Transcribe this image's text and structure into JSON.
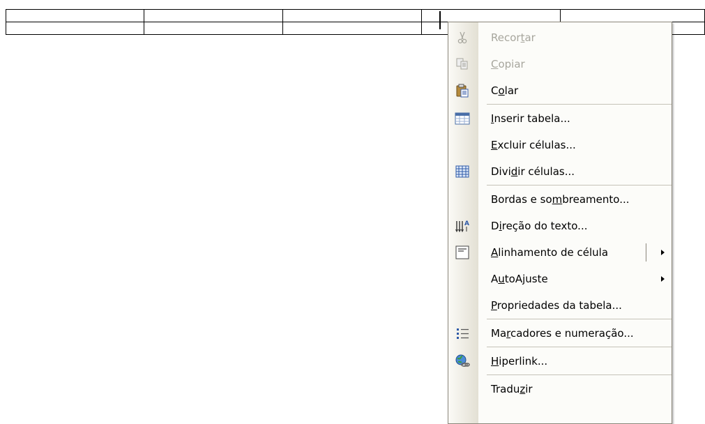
{
  "table": {
    "rows": [
      [
        "",
        "",
        "",
        "",
        ""
      ],
      [
        "",
        "",
        "",
        "",
        ""
      ]
    ]
  },
  "menu": {
    "items": [
      {
        "icon": "scissors-icon",
        "parts": [
          "Recor",
          "t",
          "ar"
        ],
        "disabled": true
      },
      {
        "icon": "copy-icon",
        "parts": [
          "",
          "C",
          "opiar"
        ],
        "disabled": true
      },
      {
        "icon": "paste-icon",
        "parts": [
          "C",
          "o",
          "lar"
        ],
        "disabled": false,
        "sep_after": true
      },
      {
        "icon": "insert-table-icon",
        "parts": [
          "",
          "I",
          "nserir tabela..."
        ],
        "disabled": false
      },
      {
        "icon": "",
        "parts": [
          "",
          "E",
          "xcluir células..."
        ],
        "disabled": false
      },
      {
        "icon": "split-cells-icon",
        "parts": [
          "Divi",
          "d",
          "ir células..."
        ],
        "disabled": false,
        "sep_after": true
      },
      {
        "icon": "",
        "parts": [
          "Bordas e so",
          "m",
          "breamento..."
        ],
        "disabled": false
      },
      {
        "icon": "text-direction-icon",
        "parts": [
          "D",
          "i",
          "reção do texto..."
        ],
        "disabled": false
      },
      {
        "icon": "cell-alignment-icon",
        "parts": [
          "",
          "A",
          "linhamento de célula"
        ],
        "disabled": false,
        "submenu": true,
        "split": true
      },
      {
        "icon": "",
        "parts": [
          "A",
          "u",
          "toAjuste"
        ],
        "disabled": false,
        "submenu": true
      },
      {
        "icon": "",
        "parts": [
          "",
          "P",
          "ropriedades da tabela..."
        ],
        "disabled": false,
        "sep_after": true
      },
      {
        "icon": "bullets-numbering-icon",
        "parts": [
          "Ma",
          "r",
          "cadores e numeração..."
        ],
        "disabled": false,
        "sep_after": true
      },
      {
        "icon": "hyperlink-icon",
        "parts": [
          "",
          "H",
          "iperlink..."
        ],
        "disabled": false,
        "sep_after": true
      },
      {
        "icon": "",
        "parts": [
          "Tradu",
          "z",
          "ir"
        ],
        "disabled": false
      }
    ]
  }
}
